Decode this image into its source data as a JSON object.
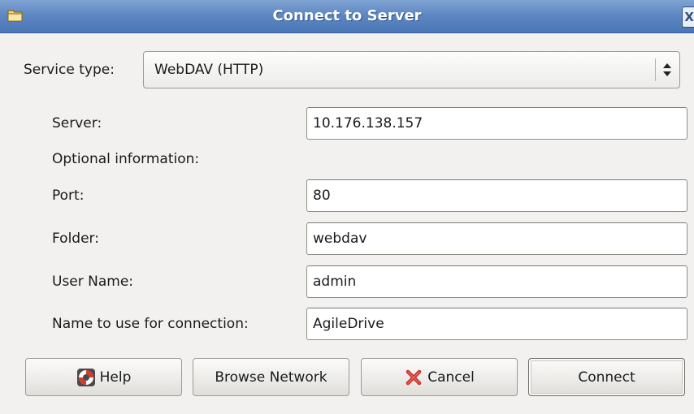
{
  "window": {
    "title": "Connect to Server",
    "icon": "folder-icon",
    "close_glyph": "X"
  },
  "service": {
    "label": "Service type:",
    "value": "WebDAV (HTTP)"
  },
  "fields": {
    "server": {
      "label": "Server:",
      "value": "10.176.138.157"
    },
    "optional_heading": "Optional information:",
    "port": {
      "label": "Port:",
      "value": "80"
    },
    "folder": {
      "label": "Folder:",
      "value": "webdav"
    },
    "user": {
      "label": "User Name:",
      "value": "admin"
    },
    "name": {
      "label": "Name to use for connection:",
      "value": "AgileDrive"
    }
  },
  "buttons": {
    "help": "Help",
    "browse": "Browse Network",
    "cancel": "Cancel",
    "connect": "Connect"
  },
  "colors": {
    "titlebar": "#5f88c3",
    "dialog_bg": "#f2f1ef",
    "cancel_x": "#c4302b"
  }
}
